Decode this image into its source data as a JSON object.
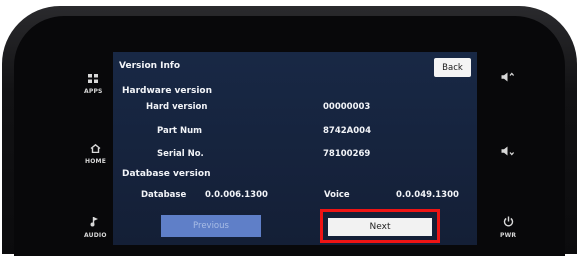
{
  "left_buttons": [
    {
      "label": "APPS",
      "icon": "apps-grid-icon"
    },
    {
      "label": "HOME",
      "icon": "home-icon"
    },
    {
      "label": "AUDIO",
      "icon": "music-note-icon"
    }
  ],
  "right_buttons": [
    {
      "label": "",
      "icon": "volume-up-icon"
    },
    {
      "label": "",
      "icon": "volume-down-icon"
    },
    {
      "label": "PWR",
      "icon": "power-icon"
    }
  ],
  "screen": {
    "title": "Version Info",
    "back_label": "Back",
    "hardware_heading": "Hardware version",
    "hard_version_label": "Hard version",
    "hard_version_value": "00000003",
    "part_num_label": "Part Num",
    "part_num_value": "8742A004",
    "serial_label": "Serial No.",
    "serial_value": "78100269",
    "database_heading": "Database version",
    "database_label": "Database",
    "database_value": "0.0.006.1300",
    "voice_label": "Voice",
    "voice_value": "0.0.049.1300",
    "previous_label": "Previous",
    "next_label": "Next"
  },
  "colors": {
    "screen_bg": "#162340",
    "highlight": "#ee1414",
    "previous_button": "#5f7fc8"
  }
}
